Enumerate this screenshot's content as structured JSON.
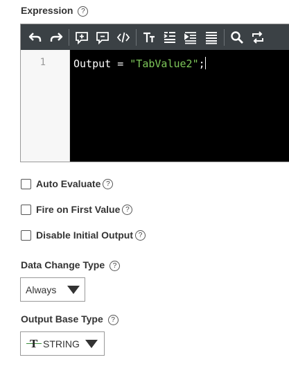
{
  "expression": {
    "label": "Expression",
    "help": "?",
    "line_number": "1",
    "code": {
      "ident": "Output",
      "op": " = ",
      "string": "\"TabValue2\"",
      "end": ";"
    }
  },
  "toolbar": {
    "buttons": [
      "undo-icon",
      "redo-icon",
      "add-comment-icon",
      "remove-comment-icon",
      "code-icon",
      "font-size-icon",
      "align-left-icon",
      "indent-icon",
      "justify-icon",
      "search-icon",
      "replace-icon"
    ]
  },
  "options": {
    "auto_evaluate": "Auto Evaluate",
    "fire_on_first": "Fire on First Value",
    "disable_initial": "Disable Initial Output",
    "help": "?"
  },
  "data_change": {
    "label": "Data Change Type",
    "help": "?",
    "value": "Always"
  },
  "output_base": {
    "label": "Output Base Type",
    "help": "?",
    "value": "STRING",
    "icon_glyph": "T"
  },
  "colors": {
    "toolbar": "#3b4145",
    "editor_bg": "#000000",
    "string": "#7ec75a",
    "type_icon": "#3a8a3a"
  }
}
